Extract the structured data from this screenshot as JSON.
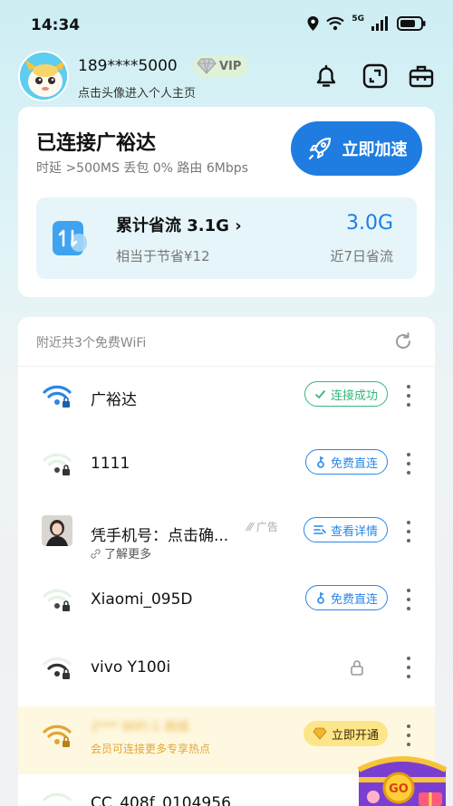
{
  "status_bar": {
    "time": "14:34",
    "network": "5G"
  },
  "header": {
    "phone": "189****5000",
    "vip_label": "VIP",
    "subtitle": "点击头像进入个人主页"
  },
  "connection": {
    "title": "已连接广裕达",
    "stats": "时延 >500MS  丢包 0%  路由 6Mbps",
    "boost_label": "立即加速"
  },
  "savings": {
    "title": "累计省流 3.1G",
    "subtitle": "相当于节省¥12",
    "value": "3.0G",
    "desc": "近7日省流"
  },
  "wifi_list": {
    "header": "附近共3个免费WiFi",
    "items": [
      {
        "name": "广裕达",
        "action": "连接成功",
        "type": "connected"
      },
      {
        "name": "1111",
        "action": "免费直连",
        "type": "free"
      },
      {
        "name": "凭手机号：点击确...",
        "ad_tag": "广告",
        "sub": "了解更多",
        "action": "查看详情",
        "type": "ad"
      },
      {
        "name": "Xiaomi_095D",
        "action": "免费直连",
        "type": "free"
      },
      {
        "name": "vivo Y100i",
        "type": "locked"
      },
      {
        "name": "2***  WiFi-1 高级",
        "sub": "会员可连接更多专享热点",
        "action": "立即开通",
        "type": "vip"
      },
      {
        "name": "CC_408f_0104956",
        "type": "partial"
      }
    ]
  },
  "colors": {
    "accent": "#1f7de1",
    "success": "#34b77a",
    "vip_gold": "#fde58a"
  },
  "floating": {
    "go_label": "GO"
  }
}
